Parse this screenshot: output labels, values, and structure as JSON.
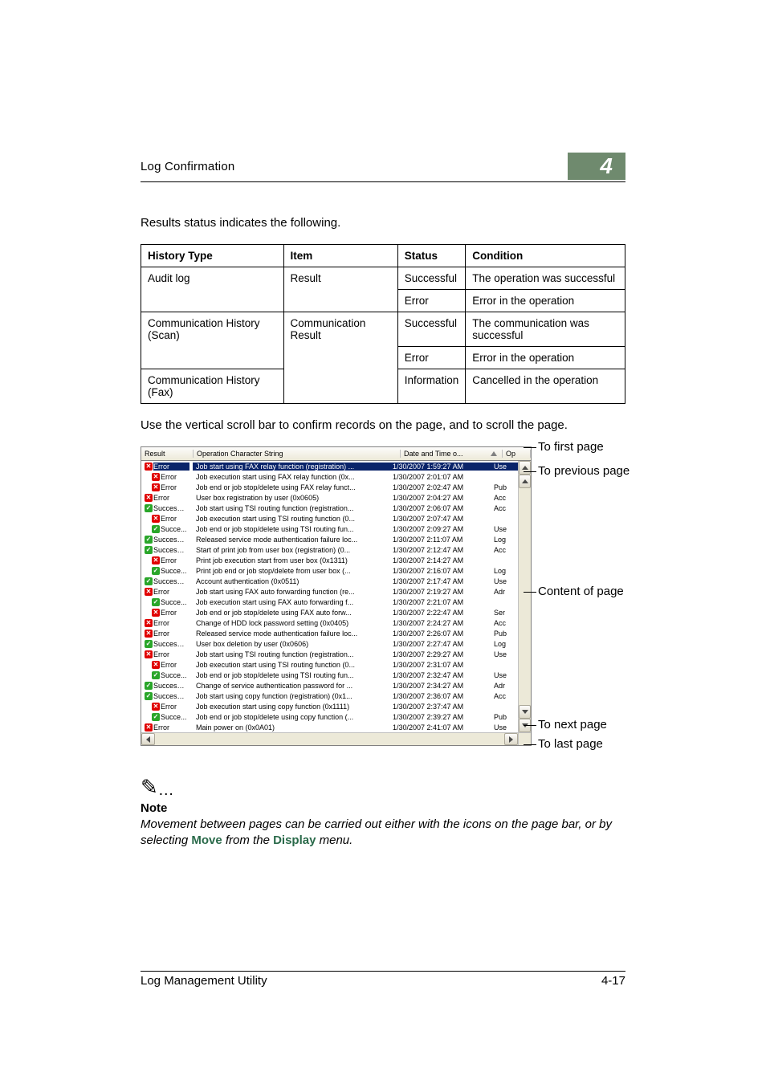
{
  "header": {
    "title": "Log Confirmation",
    "chapter": "4"
  },
  "intro_text": "Results status indicates the following.",
  "ref_table": {
    "headers": [
      "History Type",
      "Item",
      "Status",
      "Condition"
    ],
    "rows": [
      {
        "history": "Audit log",
        "item": "Result",
        "status": "Successful",
        "condition": "The operation was successful"
      },
      {
        "history": "",
        "item": "",
        "status": "Error",
        "condition": "Error in the operation"
      },
      {
        "history": "Communication History (Scan)",
        "item": "Communication Result",
        "status": "Successful",
        "condition": "The communication was successful"
      },
      {
        "history": "",
        "item": "",
        "status": "Error",
        "condition": "Error in the operation"
      },
      {
        "history": "Communication History (Fax)",
        "item": "",
        "status": "Information",
        "condition": "Cancelled in the operation"
      }
    ]
  },
  "mid_text": "Use the vertical scroll bar to confirm records on the page, and to scroll the page.",
  "log_table": {
    "columns": {
      "result": "Result",
      "op": "Operation Character String",
      "dt": "Date and Time o...",
      "last": "Op"
    },
    "rows": [
      {
        "indent": 0,
        "result": "Error",
        "selected": true,
        "op": "Job start using FAX relay function (registration) ...",
        "dt": "1/30/2007 1:59:27 AM",
        "last": "Use"
      },
      {
        "indent": 1,
        "result": "Error",
        "selected": false,
        "op": "Job execution start using FAX relay function (0x...",
        "dt": "1/30/2007 2:01:07 AM",
        "last": ""
      },
      {
        "indent": 1,
        "result": "Error",
        "selected": false,
        "op": "Job end or job stop/delete using FAX relay funct...",
        "dt": "1/30/2007 2:02:47 AM",
        "last": "Pub"
      },
      {
        "indent": 0,
        "result": "Error",
        "selected": false,
        "op": "User box registration by user (0x0605)",
        "dt": "1/30/2007 2:04:27 AM",
        "last": "Acc"
      },
      {
        "indent": 0,
        "result": "Successful",
        "selected": false,
        "op": "Job start using TSI routing function (registration...",
        "dt": "1/30/2007 2:06:07 AM",
        "last": "Acc"
      },
      {
        "indent": 1,
        "result": "Error",
        "selected": false,
        "op": "Job execution start using TSI routing function (0...",
        "dt": "1/30/2007 2:07:47 AM",
        "last": ""
      },
      {
        "indent": 1,
        "result": "Succe...",
        "selected": false,
        "op": "Job end or job stop/delete using TSI routing fun...",
        "dt": "1/30/2007 2:09:27 AM",
        "last": "Use"
      },
      {
        "indent": 0,
        "result": "Successful",
        "selected": false,
        "op": "Released service mode authentication failure loc...",
        "dt": "1/30/2007 2:11:07 AM",
        "last": "Log"
      },
      {
        "indent": 0,
        "result": "Successful",
        "selected": false,
        "op": "Start of print job from user box (registration) (0...",
        "dt": "1/30/2007 2:12:47 AM",
        "last": "Acc"
      },
      {
        "indent": 1,
        "result": "Error",
        "selected": false,
        "op": "Print job execution start from user box (0x1311)",
        "dt": "1/30/2007 2:14:27 AM",
        "last": ""
      },
      {
        "indent": 1,
        "result": "Succe...",
        "selected": false,
        "op": "Print job end or job stop/delete from user box (...",
        "dt": "1/30/2007 2:16:07 AM",
        "last": "Log"
      },
      {
        "indent": 0,
        "result": "Successful",
        "selected": false,
        "op": "Account authentication (0x0511)",
        "dt": "1/30/2007 2:17:47 AM",
        "last": "Use"
      },
      {
        "indent": 0,
        "result": "Error",
        "selected": false,
        "op": "Job start using FAX auto forwarding function (re...",
        "dt": "1/30/2007 2:19:27 AM",
        "last": "Adr"
      },
      {
        "indent": 1,
        "result": "Succe...",
        "selected": false,
        "op": "Job execution start using FAX auto forwarding f...",
        "dt": "1/30/2007 2:21:07 AM",
        "last": ""
      },
      {
        "indent": 1,
        "result": "Error",
        "selected": false,
        "op": "Job end or job stop/delete using FAX auto forw...",
        "dt": "1/30/2007 2:22:47 AM",
        "last": "Ser"
      },
      {
        "indent": 0,
        "result": "Error",
        "selected": false,
        "op": "Change of HDD lock password setting (0x0405)",
        "dt": "1/30/2007 2:24:27 AM",
        "last": "Acc"
      },
      {
        "indent": 0,
        "result": "Error",
        "selected": false,
        "op": "Released service mode authentication failure loc...",
        "dt": "1/30/2007 2:26:07 AM",
        "last": "Pub"
      },
      {
        "indent": 0,
        "result": "Successful",
        "selected": false,
        "op": "User box deletion by user (0x0606)",
        "dt": "1/30/2007 2:27:47 AM",
        "last": "Log"
      },
      {
        "indent": 0,
        "result": "Error",
        "selected": false,
        "op": "Job start using TSI routing function (registration...",
        "dt": "1/30/2007 2:29:27 AM",
        "last": "Use"
      },
      {
        "indent": 1,
        "result": "Error",
        "selected": false,
        "op": "Job execution start using TSI routing function (0...",
        "dt": "1/30/2007 2:31:07 AM",
        "last": ""
      },
      {
        "indent": 1,
        "result": "Succe...",
        "selected": false,
        "op": "Job end or job stop/delete using TSI routing fun...",
        "dt": "1/30/2007 2:32:47 AM",
        "last": "Use"
      },
      {
        "indent": 0,
        "result": "Successful",
        "selected": false,
        "op": "Change of service authentication password for ...",
        "dt": "1/30/2007 2:34:27 AM",
        "last": "Adr"
      },
      {
        "indent": 0,
        "result": "Successful",
        "selected": false,
        "op": "Job start using copy function (registration) (0x1...",
        "dt": "1/30/2007 2:36:07 AM",
        "last": "Acc"
      },
      {
        "indent": 1,
        "result": "Error",
        "selected": false,
        "op": "Job execution start using copy function (0x1111)",
        "dt": "1/30/2007 2:37:47 AM",
        "last": ""
      },
      {
        "indent": 1,
        "result": "Succe...",
        "selected": false,
        "op": "Job end or job stop/delete using copy function (...",
        "dt": "1/30/2007 2:39:27 AM",
        "last": "Pub"
      },
      {
        "indent": 0,
        "result": "Error",
        "selected": false,
        "op": "Main power on (0x0A01)",
        "dt": "1/30/2007 2:41:07 AM",
        "last": "Use"
      }
    ]
  },
  "callouts": {
    "first": "To first page",
    "prev": "To previous page",
    "content": "Content of page",
    "next": "To next page",
    "last": "To last page"
  },
  "note": {
    "label": "Note",
    "body_prefix": "Movement between pages can be carried out either with the icons on the page bar, or by selecting ",
    "kw1": "Move",
    "body_mid": " from the ",
    "kw2": "Display",
    "body_suffix": " menu."
  },
  "footer": {
    "left": "Log Management Utility",
    "right": "4-17"
  }
}
